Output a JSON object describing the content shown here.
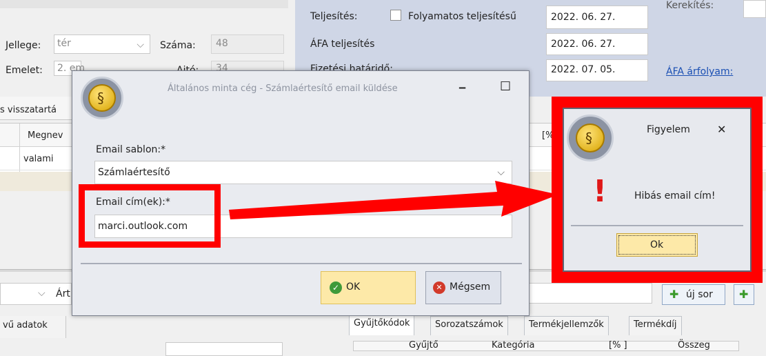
{
  "background": {
    "jellege_label": "Jellege:",
    "jellege_value": "tér",
    "szama_label": "Száma:",
    "szama_value": "48",
    "emelet_label": "Emelet:",
    "emelet_value": "2. em",
    "ajto_label": "Ajtó:",
    "ajto_value": "34",
    "teljesites_label": "Teljesítés:",
    "folyamatos_label": "Folyamatos teljesítésű",
    "teljesites_date": "2022. 06. 27.",
    "afa_teljesites_label": "ÁFA teljesítés",
    "afa_teljesites_date": "2022. 06. 27.",
    "fizetesi_label": "Fizetési határidő:",
    "fizetesi_date": "2022. 07. 05.",
    "afa_arfolyam_link": "ÁFA árfolyam:",
    "kerekites_label": "Kerekítés:",
    "visszatartas_label": "s visszatartá",
    "col_megnev": "Megnev",
    "col_pct": "[%",
    "row_value": "valami",
    "art_label": "Árt",
    "uj_sor_label": "új sor",
    "egyedi_label": "vű adatok",
    "tabs": [
      "Gyűjtőkódok",
      "Sorozatszámok",
      "Termékjellemzők",
      "Termékdíj"
    ],
    "bottom_headers": [
      "Gyűjtő",
      "Kategória",
      "[% ]",
      "Összeg"
    ]
  },
  "email_dialog": {
    "title": "Általános minta cég - Számlaértesítő email küldése",
    "minimize_glyph": "‒",
    "maximize_glyph": "☐",
    "template_label": "Email sablon:*",
    "template_value": "Számlaértesítő",
    "email_label": "Email cím(ek):*",
    "email_value": "marci.outlook.com",
    "ok_label": "OK",
    "cancel_label": "Mégsem"
  },
  "alert_dialog": {
    "title": "Figyelem",
    "close_glyph": "✕",
    "message": "Hibás email cím!",
    "ok_label": "Ok",
    "exclamation": "!"
  },
  "colors": {
    "highlight_red": "#ff0000",
    "dialog_bg": "#e9ebf0",
    "blue_panel": "#cfd6e6",
    "ok_button": "#fde9a8"
  }
}
